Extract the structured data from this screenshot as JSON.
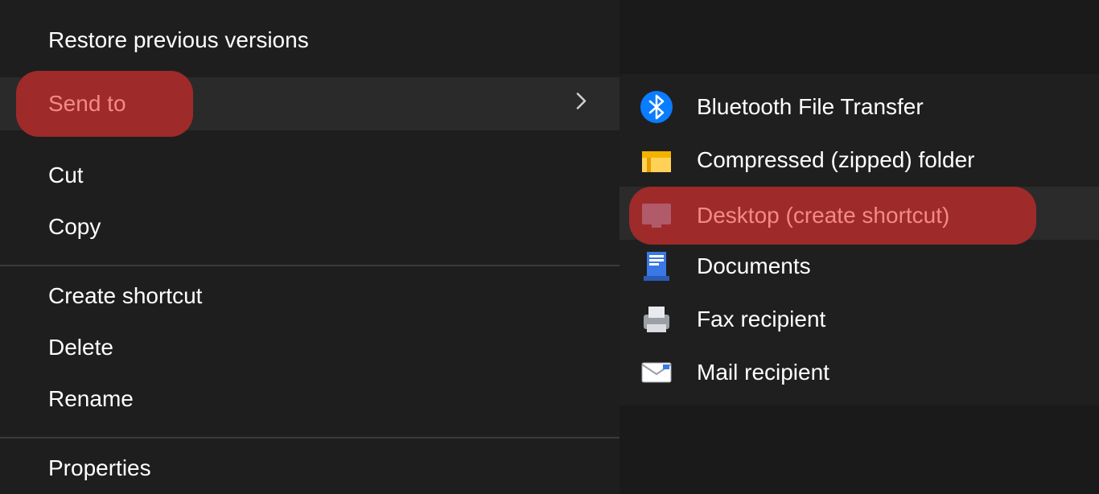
{
  "menu": {
    "restore": "Restore previous versions",
    "sendto": "Send to",
    "cut": "Cut",
    "copy": "Copy",
    "create_shortcut": "Create shortcut",
    "delete": "Delete",
    "rename": "Rename",
    "properties": "Properties"
  },
  "submenu": {
    "bluetooth": "Bluetooth File Transfer",
    "compressed": "Compressed (zipped) folder",
    "desktop": "Desktop (create shortcut)",
    "documents": "Documents",
    "fax": "Fax recipient",
    "mail": "Mail recipient"
  }
}
